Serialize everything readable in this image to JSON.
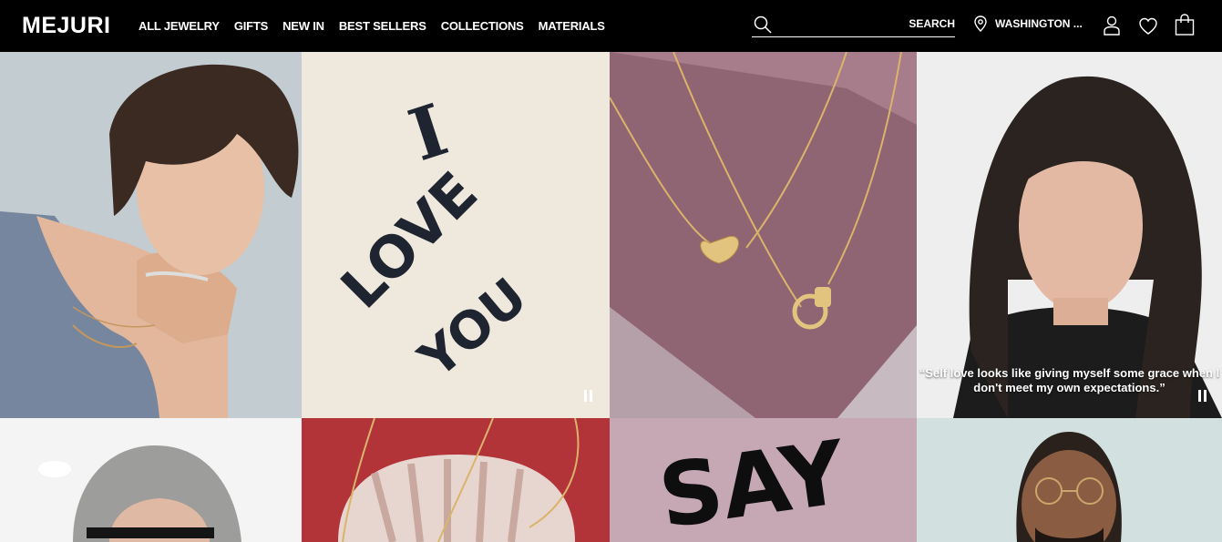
{
  "header": {
    "logo": "MEJURI",
    "nav": [
      "ALL JEWELRY",
      "GIFTS",
      "NEW IN",
      "BEST SELLERS",
      "COLLECTIONS",
      "MATERIALS"
    ],
    "search_label": "SEARCH",
    "location": "WASHINGTON ..."
  },
  "tiles": {
    "handwriting_1": [
      "I",
      "LOVE",
      "YOU"
    ],
    "quote": "“Self love looks like giving myself some grace when I don't meet my own expectations.”",
    "handwriting_2": "SAY"
  }
}
